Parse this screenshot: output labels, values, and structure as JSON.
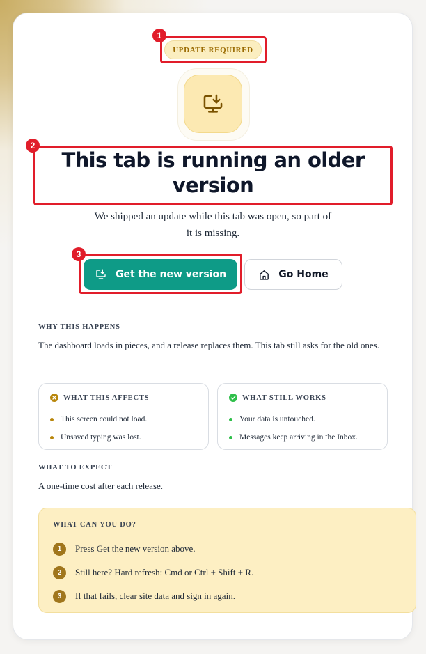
{
  "colors": {
    "accent_teal": "#0e9b87",
    "badge_bg": "#fbeec0",
    "badge_text": "#9a6a00",
    "annotation_red": "#e11d2a",
    "error_icon": "#b8860b",
    "success_icon": "#2fbf4a",
    "callout_bg": "#fdefc3",
    "step_badge": "#a0761c"
  },
  "annotations": [
    "1",
    "2",
    "3"
  ],
  "badge": {
    "label": "UPDATE REQUIRED"
  },
  "hero": {
    "icon": "monitor-download-icon",
    "title": "This tab is running an older version",
    "subtitle": "We shipped an update while this tab was open, so part of it is missing."
  },
  "actions": {
    "primary_label": "Get the new version",
    "primary_icon": "download-icon",
    "secondary_label": "Go Home",
    "secondary_icon": "home-icon"
  },
  "why": {
    "label": "WHY THIS HAPPENS",
    "text": "The dashboard loads in pieces, and a release replaces them. This tab still asks for the old ones."
  },
  "affects": {
    "label": "WHAT THIS AFFECTS",
    "icon": "x-circle-icon",
    "items": [
      "This screen could not load.",
      "Unsaved typing was lost."
    ]
  },
  "works": {
    "label": "WHAT STILL WORKS",
    "icon": "check-circle-icon",
    "items": [
      "Your data is untouched.",
      "Messages keep arriving in the Inbox."
    ]
  },
  "expect": {
    "label": "WHAT TO EXPECT",
    "text": "A one-time cost after each release."
  },
  "todo": {
    "label": "WHAT CAN YOU DO?",
    "steps": [
      {
        "num": "1",
        "text": "Press Get the new version above."
      },
      {
        "num": "2",
        "text": "Still here? Hard refresh: Cmd or Ctrl + Shift + R."
      },
      {
        "num": "3",
        "text": "If that fails, clear site data and sign in again."
      }
    ]
  }
}
